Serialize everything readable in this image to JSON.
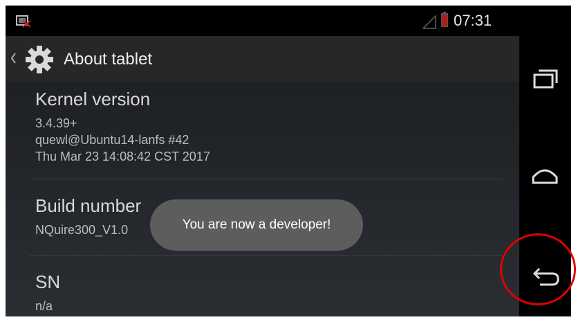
{
  "status_bar": {
    "time": "07:31",
    "icons": [
      "screenshot-notification-icon",
      "signal-icon",
      "battery-icon"
    ]
  },
  "action_bar": {
    "title": "About tablet",
    "icon": "settings-gear-icon"
  },
  "settings_list": [
    {
      "title": "Kernel version",
      "summary": "3.4.39+\nquewl@Ubuntu14-lanfs #42\nThu Mar 23 14:08:42 CST 2017"
    },
    {
      "title": "Build number",
      "summary": "NQuire300_V1.0"
    },
    {
      "title": "SN",
      "summary": "n/a"
    }
  ],
  "toast": {
    "message": "You are now a developer!"
  },
  "nav_bar": {
    "buttons": [
      "recent-apps-icon",
      "home-icon",
      "back-icon"
    ]
  },
  "colors": {
    "annotation_ring": "#e00000",
    "battery": "#b01c1c",
    "toast_bg": "#626262"
  }
}
